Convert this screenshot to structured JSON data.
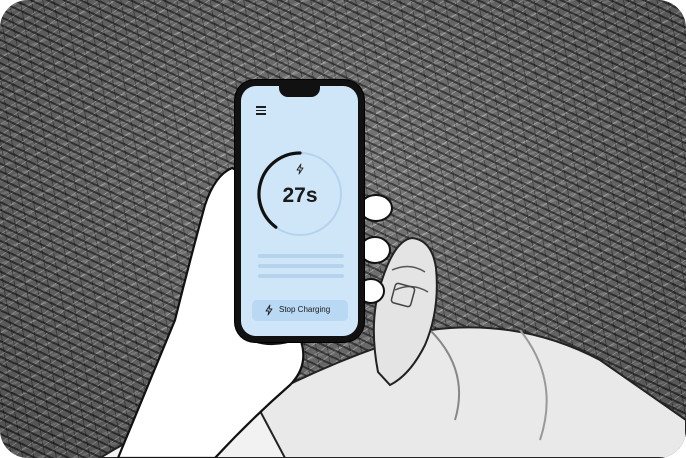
{
  "app": {
    "menu_icon": "hamburger-menu-icon",
    "charging_icon": "lightning-bolt-icon",
    "timer_value": "27s",
    "timer_progress": 0.4,
    "stop_button": {
      "label": "Stop Charging",
      "icon": "lightning-bolt-icon"
    }
  },
  "colors": {
    "screen_background": "#cfe6f9",
    "button_background": "#b8d8f3",
    "progress_arc": "#111111",
    "progress_track": "#b6d3ee",
    "text": "#1a1a1a"
  }
}
